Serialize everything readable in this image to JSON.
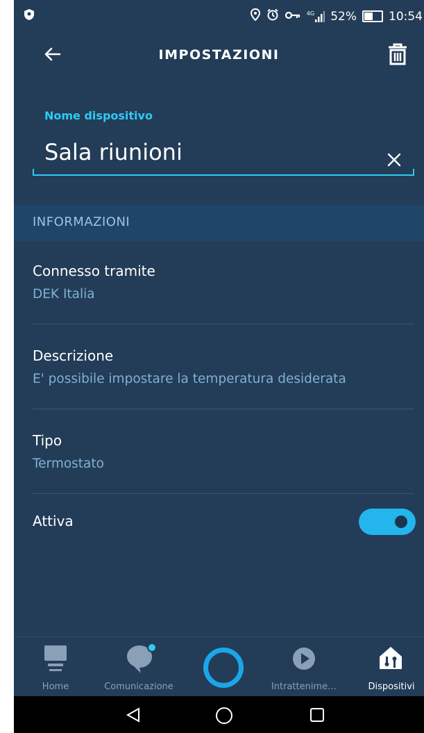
{
  "status_bar": {
    "network": "4G",
    "battery": "52%",
    "time": "10:54",
    "icons": [
      "shield-icon",
      "location-icon",
      "alarm-icon",
      "vpn-key-icon",
      "signal-icon",
      "battery-icon"
    ]
  },
  "header": {
    "title": "IMPOSTAZIONI",
    "back_icon": "arrow-left-icon",
    "delete_icon": "trash-icon"
  },
  "device_name": {
    "label": "Nome dispositivo",
    "value": "Sala riunioni",
    "clear_icon": "close-icon"
  },
  "section": {
    "title": "INFORMAZIONI"
  },
  "info": [
    {
      "title": "Connesso tramite",
      "value": "DEK Italia"
    },
    {
      "title": "Descrizione",
      "value": "E' possibile impostare la temperatura desiderata"
    },
    {
      "title": "Tipo",
      "value": "Termostato"
    }
  ],
  "active": {
    "label": "Attiva",
    "enabled": true
  },
  "bottom_nav": {
    "items": [
      {
        "label": "Home",
        "icon": "home-icon"
      },
      {
        "label": "Comunicazione",
        "icon": "chat-icon"
      },
      {
        "label": "",
        "icon": "alexa-ring-icon"
      },
      {
        "label": "Intrattenime…",
        "icon": "play-icon"
      },
      {
        "label": "Dispositivi",
        "icon": "devices-icon"
      }
    ],
    "active": "Dispositivi"
  },
  "system_nav": {
    "icons": [
      "back-triangle-icon",
      "home-circle-icon",
      "recents-square-icon"
    ]
  },
  "colors": {
    "background": "#233c57",
    "accent": "#2ecbf5",
    "section_bg": "#1f4668",
    "toggle_on": "#23b5ec"
  }
}
